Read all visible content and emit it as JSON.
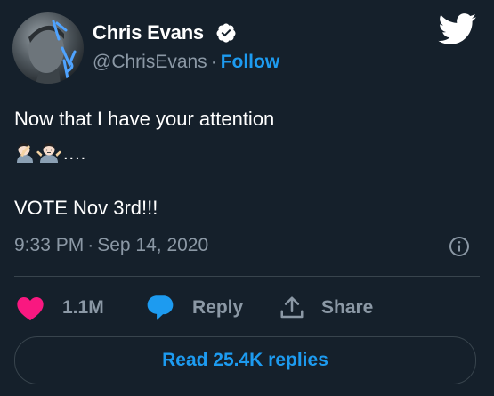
{
  "author": {
    "display_name": "Chris Evans",
    "handle": "@ChrisEvans",
    "separator": "·",
    "follow_label": "Follow",
    "verified": true
  },
  "tweet": {
    "line1": "Now that I have your attention",
    "emoji_dots": "....",
    "emoji_icons": [
      "man-facepalming-emoji",
      "man-shrugging-emoji"
    ],
    "line2": "VOTE Nov 3rd!!!"
  },
  "meta": {
    "time": "9:33 PM",
    "separator": "·",
    "date": "Sep 14, 2020"
  },
  "actions": {
    "like_count": "1.1M",
    "reply_label": "Reply",
    "share_label": "Share"
  },
  "footer": {
    "read_replies_label": "Read 25.4K replies"
  },
  "colors": {
    "background": "#15202b",
    "accent": "#1d9bf0",
    "like": "#f91880",
    "muted": "#8b98a5",
    "border": "#38444d"
  }
}
